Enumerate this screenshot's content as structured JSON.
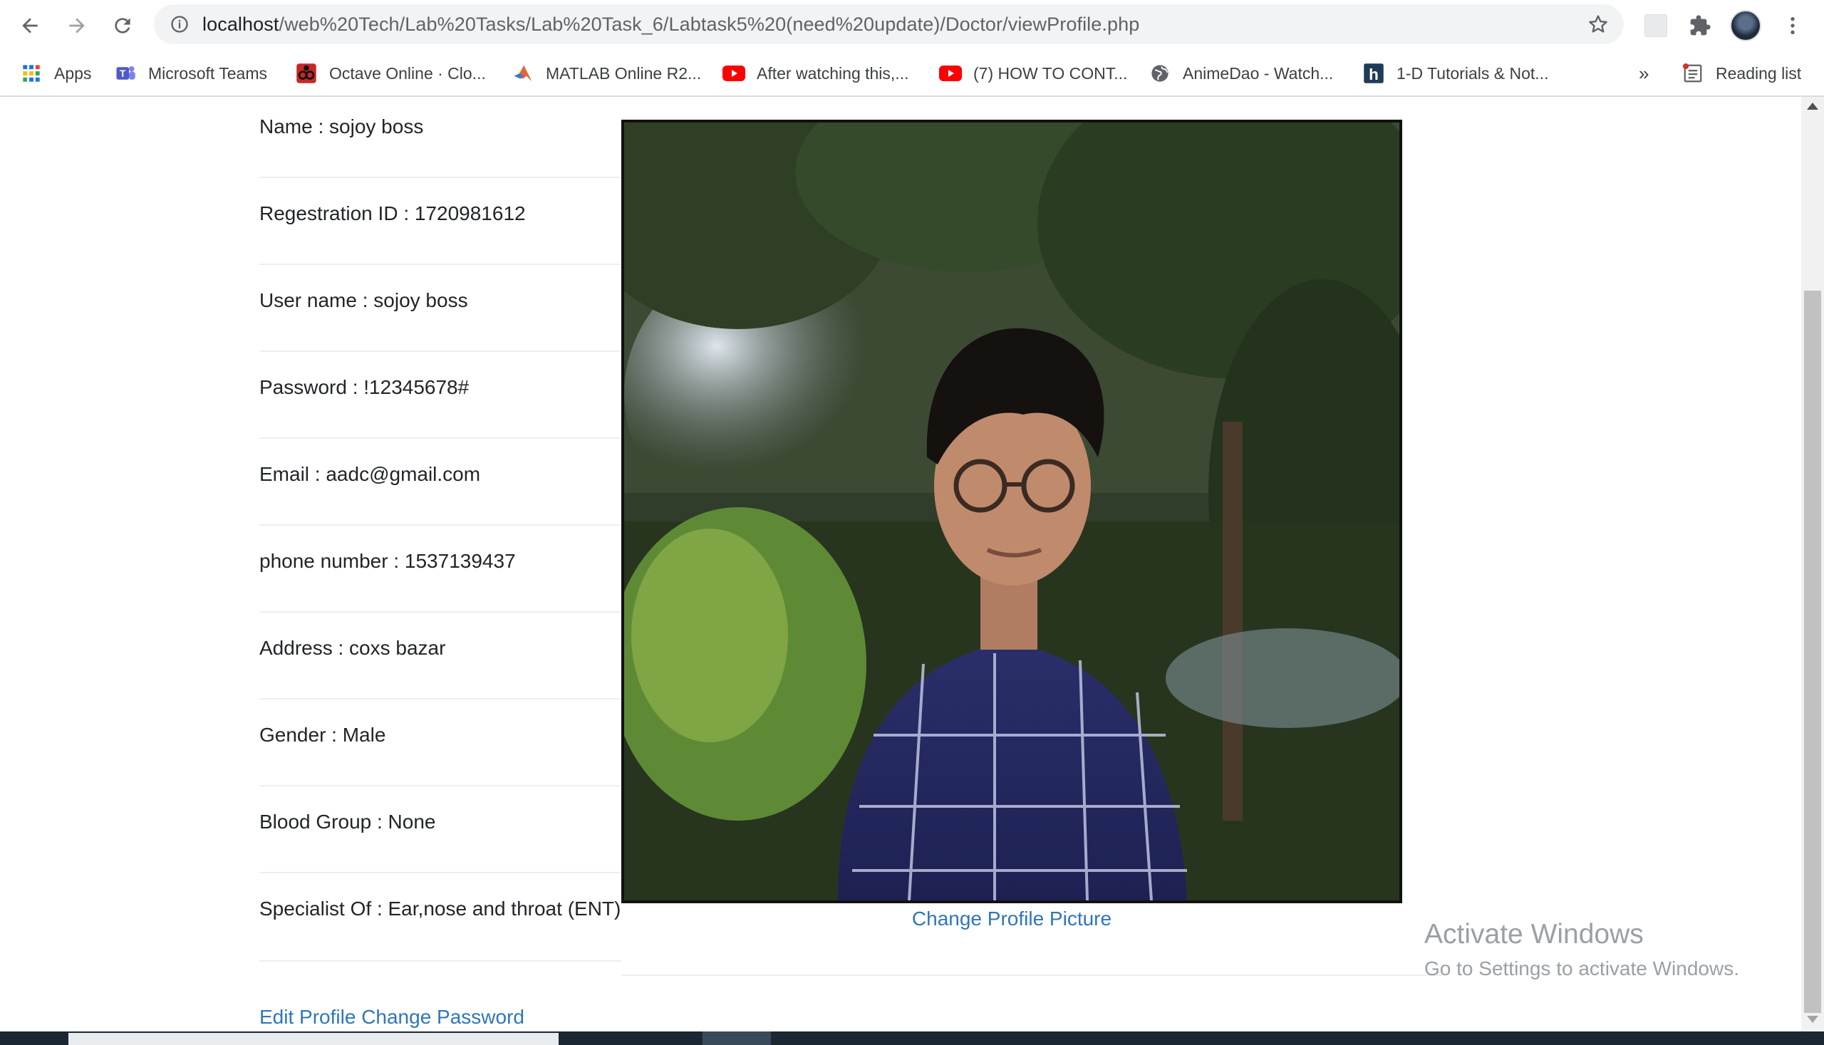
{
  "browser": {
    "url_host": "localhost",
    "url_path": "/web%20Tech/Lab%20Tasks/Lab%20Task_6/Labtask5%20(need%20update)/Doctor/viewProfile.php",
    "bookmarks": [
      {
        "label": "Apps",
        "icon": "apps-grid-icon"
      },
      {
        "label": "Microsoft Teams",
        "icon": "teams-icon"
      },
      {
        "label": "Octave Online · Clo...",
        "icon": "octave-icon"
      },
      {
        "label": "MATLAB Online R2...",
        "icon": "matlab-icon"
      },
      {
        "label": "After watching this,...",
        "icon": "youtube-icon"
      },
      {
        "label": "(7) HOW TO CONT...",
        "icon": "youtube-icon"
      },
      {
        "label": "AnimeDao - Watch...",
        "icon": "globe-icon"
      },
      {
        "label": "1-D Tutorials & Not...",
        "icon": "h-icon"
      }
    ],
    "overflow_label": "»",
    "reading_list_label": "Reading list"
  },
  "profile": {
    "fields": [
      {
        "text": "Name : sojoy boss"
      },
      {
        "text": "Regestration ID : 1720981612"
      },
      {
        "text": "User name : sojoy boss"
      },
      {
        "text": "Password : !12345678#"
      },
      {
        "text": "Email : aadc@gmail.com"
      },
      {
        "text": "phone number : 1537139437"
      },
      {
        "text": "Address : coxs bazar"
      },
      {
        "text": "Gender : Male"
      },
      {
        "text": "Blood Group : None"
      },
      {
        "text": "Specialist Of : Ear,nose and throat (ENT)"
      }
    ],
    "change_picture_label": "Change Profile Picture",
    "edit_profile_label": "Edit Profile",
    "change_password_label": "Change Password"
  },
  "watermark": {
    "title": "Activate Windows",
    "subtitle": "Go to Settings to activate Windows."
  },
  "colors": {
    "link": "#2f76b9",
    "text": "#212529",
    "divider": "#eeeeee"
  }
}
